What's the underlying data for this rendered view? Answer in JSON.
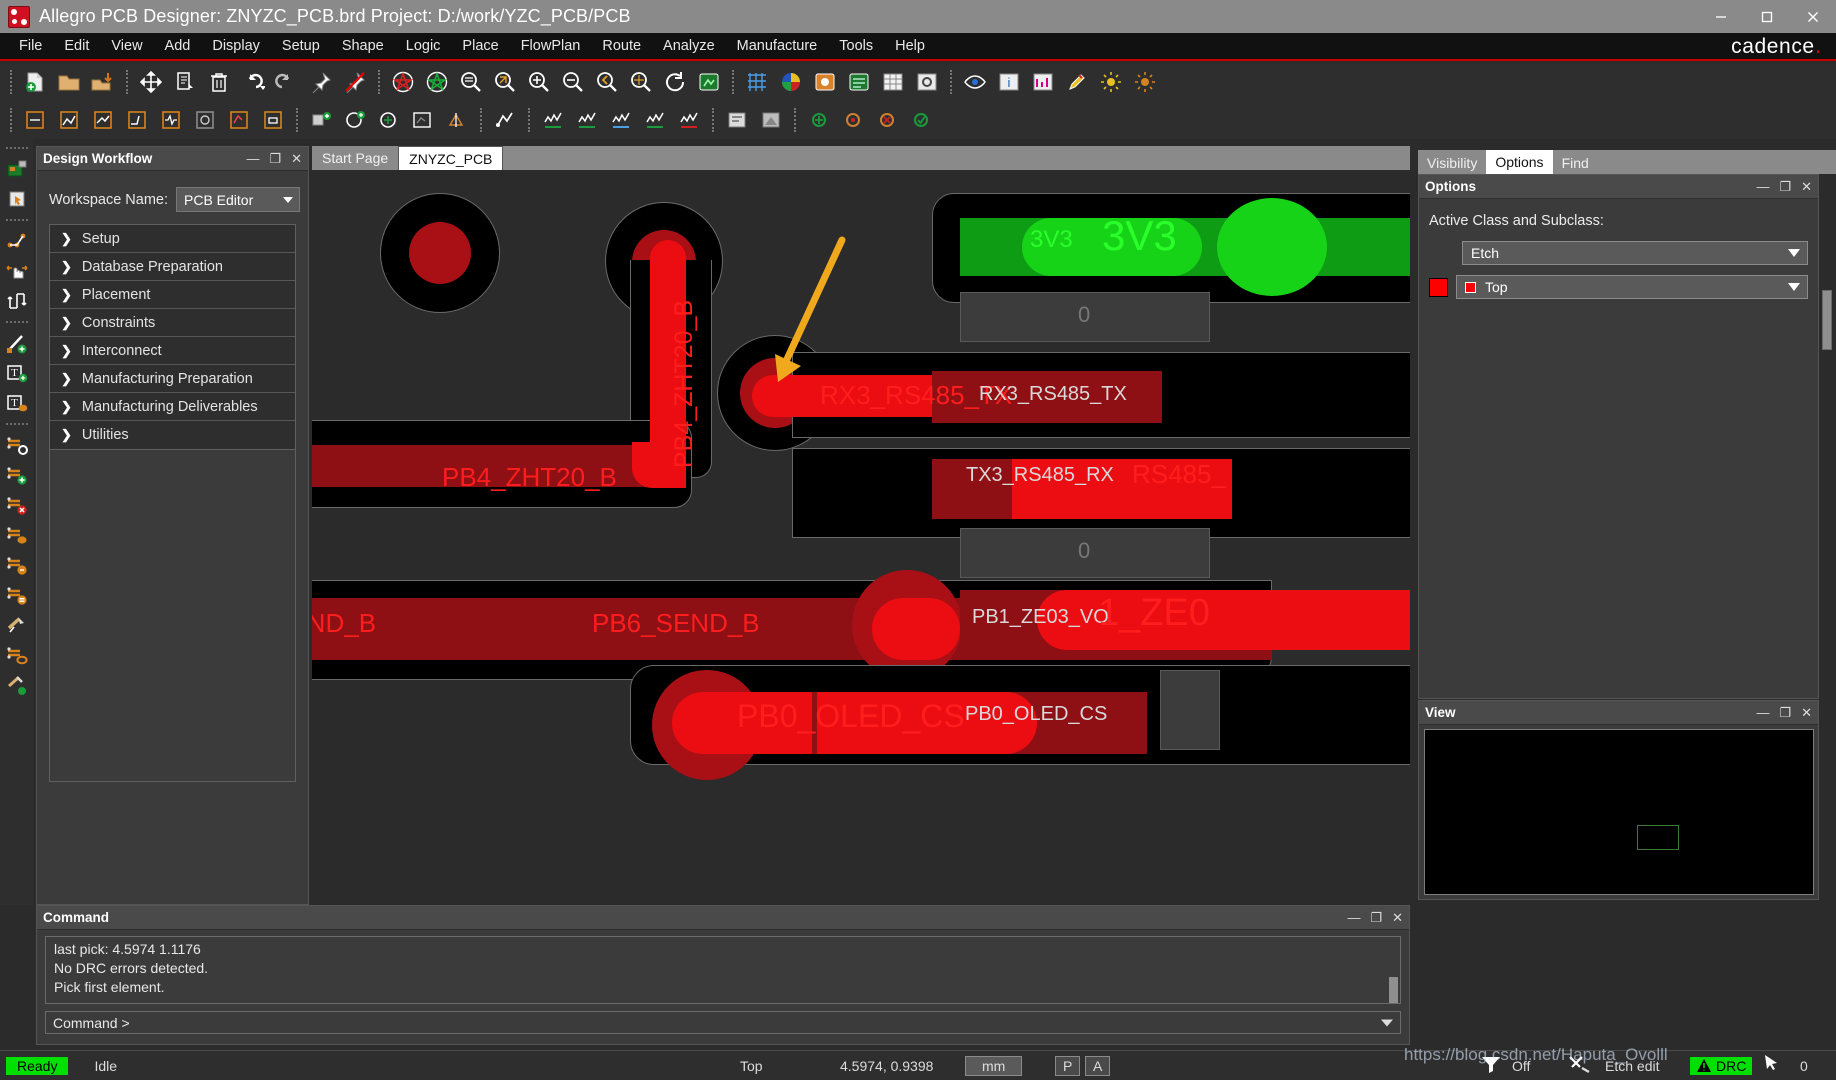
{
  "titlebar": {
    "app_title": "Allegro PCB Designer: ZNYZC_PCB.brd  Project: D:/work/YZC_PCB/PCB",
    "logo_name": "cadence-logo-icon",
    "minimize": "—",
    "maximize": "❐",
    "close": "✕"
  },
  "menubar": {
    "items": [
      "File",
      "Edit",
      "View",
      "Add",
      "Display",
      "Setup",
      "Shape",
      "Logic",
      "Place",
      "FlowPlan",
      "Route",
      "Analyze",
      "Manufacture",
      "Tools",
      "Help"
    ],
    "brand": "cadence"
  },
  "toolbar_row1": [
    "new-file-icon",
    "open-folder-icon",
    "save-icon",
    "sep",
    "move-icon",
    "copy-icon",
    "delete-icon",
    "undo-icon",
    "redo-icon",
    "pin-icon",
    "unpin-icon",
    "sep",
    "plot-red-icon",
    "plot-green-icon",
    "zoom-fit-icon",
    "zoom-by-points-icon",
    "zoom-in-icon",
    "zoom-out-icon",
    "zoom-previous-icon",
    "zoom-center-icon",
    "redraw-icon",
    "refresh-icon",
    "sep",
    "grid-toggle-icon",
    "color-pie-icon",
    "color-visibility-icon",
    "layer-icon",
    "spreadsheet-icon",
    "setup-gear-icon",
    "sep",
    "eye-icon",
    "info-icon",
    "measure-icon",
    "highlight-icon",
    "brightness-icon",
    "contrast-icon"
  ],
  "toolbar_row2": [
    "dimension-icon",
    "net-schedule-icon",
    "slide-icon",
    "custom-smooth-icon",
    "delay-tune-icon",
    "phase-tune-icon",
    "rect-icon",
    "sep",
    "place-manual-icon",
    "quickplace-icon",
    "swap-icon",
    "autoplace-icon",
    "mirror-icon",
    "sep",
    "zcopy-icon",
    "tnode-icon",
    "measure-length-icon",
    "sep",
    "shape-add-icon",
    "shape-edit-icon",
    "shape-delete-icon",
    "shape-check-icon",
    "shape-merge-icon",
    "sep",
    "route-connect-icon",
    "slide-route-icon",
    "vertex-icon",
    "delay-icon",
    "spread-icon",
    "fanout-icon",
    "gloss-icon",
    "sep",
    "drill-icon",
    "ncdrill-icon",
    "sep",
    "add-via-icon",
    "via-struct-icon",
    "via-delete-icon",
    "via-check-icon"
  ],
  "left_toolbar": [
    "board-geometry-icon",
    "component-select-icon",
    "sep",
    "net-connect-icon",
    "drag-hand-icon",
    "slide-route-icon",
    "sep",
    "add-line-icon",
    "add-text-icon",
    "edit-text-icon",
    "sep",
    "shape-setup-icon",
    "shape-add-icon",
    "shape-delete-icon",
    "shape-edit-icon",
    "shape-change-icon",
    "shape-list-icon",
    "shape-compose-icon",
    "shape-void-icon",
    "shape-tools-icon"
  ],
  "design_workflow": {
    "title": "Design Workflow",
    "minimize": "—",
    "restore": "❐",
    "close": "✕",
    "workspace_label": "Workspace Name:",
    "workspace_value": "PCB Editor",
    "items": [
      {
        "label": "Setup"
      },
      {
        "label": "Database Preparation"
      },
      {
        "label": "Placement"
      },
      {
        "label": "Constraints"
      },
      {
        "label": "Interconnect"
      },
      {
        "label": "Manufacturing Preparation"
      },
      {
        "label": "Manufacturing Deliverables"
      },
      {
        "label": "Utilities"
      }
    ]
  },
  "canvas": {
    "tabs": [
      {
        "label": "Start Page",
        "active": false
      },
      {
        "label": "ZNYZC_PCB",
        "active": true
      }
    ],
    "net_labels": [
      {
        "text": "PB4_ZHT20_B",
        "color": "red",
        "rotated": true
      },
      {
        "text": "PB4_ZHT20_B",
        "color": "red",
        "rotated": false
      },
      {
        "text": "3V3",
        "color": "green",
        "size": "small"
      },
      {
        "text": "3V3",
        "color": "green",
        "size": "large"
      },
      {
        "text": "0",
        "color": "gray"
      },
      {
        "text": "RX3_RS485_TX",
        "color": "red"
      },
      {
        "text": "RX3_RS485_TX",
        "color": "white"
      },
      {
        "text": "TX3_RS485_RX",
        "color": "white"
      },
      {
        "text": "RS485_",
        "color": "red"
      },
      {
        "text": "0",
        "color": "gray"
      },
      {
        "text": "SEND_B",
        "color": "red"
      },
      {
        "text": "PB6_SEND_B",
        "color": "red"
      },
      {
        "text": "PB1_ZE03_VO",
        "color": "white"
      },
      {
        "text": "1_ZE0",
        "color": "red"
      },
      {
        "text": "PB0_OLED_CS",
        "color": "red"
      },
      {
        "text": "PB0_OLED_CS",
        "color": "white"
      }
    ],
    "annotation_arrow": "orange-pointer-arrow-icon"
  },
  "right_dock": {
    "tabs": [
      {
        "label": "Visibility",
        "active": false
      },
      {
        "label": "Options",
        "active": true
      },
      {
        "label": "Find",
        "active": false
      }
    ],
    "options": {
      "title": "Options",
      "minimize": "—",
      "restore": "❐",
      "close": "✕",
      "section_label": "Active Class and Subclass:",
      "class_value": "Etch",
      "subclass_value": "Top",
      "swatch_color": "#ff0000"
    },
    "view": {
      "title": "View",
      "minimize": "—",
      "restore": "❐",
      "close": "✕"
    }
  },
  "command_panel": {
    "title": "Command",
    "minimize": "—",
    "restore": "❐",
    "close": "✕",
    "output_lines": [
      "last pick:  4.5974 1.1176",
      "No DRC errors detected.",
      "Pick first element."
    ],
    "prompt": "Command >"
  },
  "statusbar": {
    "ready": "Ready",
    "state": "Idle",
    "layer": "Top",
    "coordinates": "4.5974, 0.9398",
    "units": "mm",
    "pick_mode": "P",
    "angle_mode": "A",
    "filter_icon": "funnel-icon",
    "filter_state": "Off",
    "tool_icon": "tools-icon",
    "mode": "Etch edit",
    "drc_icon": "warning-triangle-icon",
    "drc_label": "DRC",
    "cursor_icon": "cursor-arrow-icon",
    "drc_count": "0"
  },
  "watermark": "https://blog.csdn.net/Haputa_Ovolll"
}
